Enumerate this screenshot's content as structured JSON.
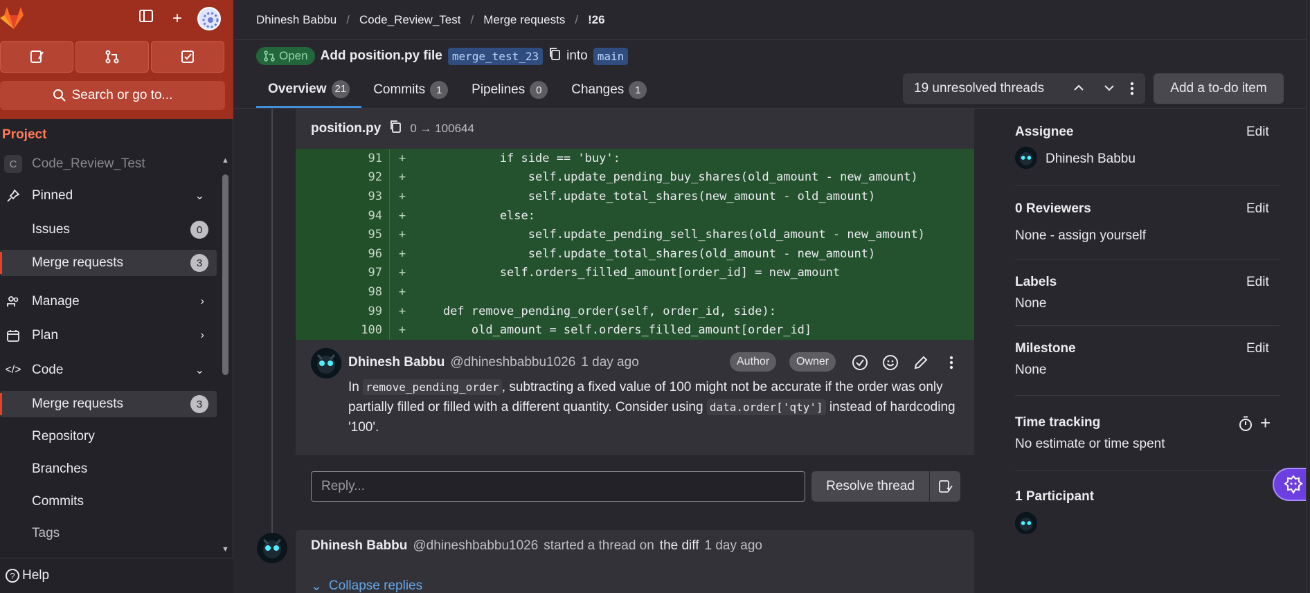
{
  "sidebar": {
    "search_label": "Search or go to...",
    "section_title": "Project",
    "project_name": "Code_Review_Test",
    "project_initial": "C",
    "items": [
      {
        "label": "Pinned"
      },
      {
        "label": "Issues",
        "badge": "0"
      },
      {
        "label": "Merge requests",
        "badge": "3"
      },
      {
        "label": "Manage"
      },
      {
        "label": "Plan"
      },
      {
        "label": "Code"
      },
      {
        "label": "Merge requests",
        "badge": "3"
      },
      {
        "label": "Repository"
      },
      {
        "label": "Branches"
      },
      {
        "label": "Commits"
      },
      {
        "label": "Tags"
      }
    ],
    "help_label": "Help"
  },
  "breadcrumb": {
    "items": [
      "Dhinesh Babbu",
      "Code_Review_Test",
      "Merge requests",
      "!26"
    ]
  },
  "mr": {
    "status": "Open",
    "title": "Add position.py file",
    "source_branch": "merge_test_23",
    "into": "into",
    "target_branch": "main"
  },
  "tabs": [
    {
      "label": "Overview",
      "count": "21"
    },
    {
      "label": "Commits",
      "count": "1"
    },
    {
      "label": "Pipelines",
      "count": "0"
    },
    {
      "label": "Changes",
      "count": "1"
    }
  ],
  "threads": {
    "label": "19 unresolved threads"
  },
  "todo_label": "Add a to-do item",
  "diff": {
    "filename": "position.py",
    "mode": "0 → 100644",
    "lines": [
      {
        "n": "91",
        "text": "            if side == 'buy':"
      },
      {
        "n": "92",
        "text": "                self.update_pending_buy_shares(old_amount - new_amount)"
      },
      {
        "n": "93",
        "text": "                self.update_total_shares(new_amount - old_amount)"
      },
      {
        "n": "94",
        "text": "            else:"
      },
      {
        "n": "95",
        "text": "                self.update_pending_sell_shares(old_amount - new_amount)"
      },
      {
        "n": "96",
        "text": "                self.update_total_shares(old_amount - new_amount)"
      },
      {
        "n": "97",
        "text": "            self.orders_filled_amount[order_id] = new_amount"
      },
      {
        "n": "98",
        "text": ""
      },
      {
        "n": "99",
        "text": "    def remove_pending_order(self, order_id, side):"
      },
      {
        "n": "100",
        "text": "        old_amount = self.orders_filled_amount[order_id]"
      }
    ]
  },
  "comment": {
    "author": "Dhinesh Babbu",
    "handle": "@dhineshbabbu1026",
    "time": "1 day ago",
    "badge_author": "Author",
    "badge_owner": "Owner",
    "body_1": "In ",
    "code_1": "remove_pending_order",
    "body_2": ", subtracting a fixed value of 100 might not be accurate if the order was only partially filled or filled with a different quantity. Consider using ",
    "code_2": "data.order['qty']",
    "body_3": " instead of hardcoding '100'."
  },
  "reply": {
    "placeholder": "Reply...",
    "resolve_label": "Resolve thread"
  },
  "thread2": {
    "author": "Dhinesh Babbu",
    "handle": "@dhineshbabbu1026",
    "text_1": "started a thread on",
    "link": "the diff",
    "time": "1 day ago",
    "collapse_label": "Collapse replies"
  },
  "right": {
    "assignee_title": "Assignee",
    "assignee_name": "Dhinesh Babbu",
    "reviewers_title": "0 Reviewers",
    "reviewers_value": "None - assign yourself",
    "labels_title": "Labels",
    "labels_value": "None",
    "milestone_title": "Milestone",
    "milestone_value": "None",
    "time_title": "Time tracking",
    "time_value": "No estimate or time spent",
    "participants_title": "1 Participant",
    "edit_label": "Edit"
  }
}
